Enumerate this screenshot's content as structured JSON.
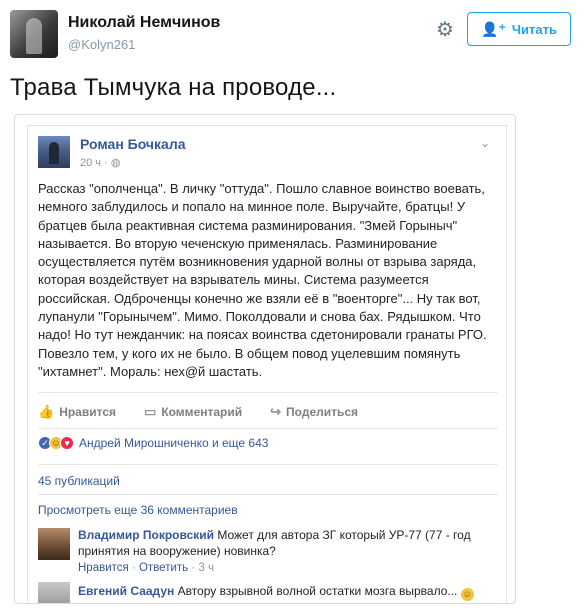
{
  "tweet": {
    "display_name": "Николай Немчинов",
    "handle": "@Kolyn261",
    "follow_label": "Читать",
    "text": "Трава Тымчука на проводе..."
  },
  "fb_post": {
    "author": "Роман Бочкала",
    "time": "20 ч · ",
    "body_lines": [
      "Рассказ \"ополченца\". В личку \"оттуда\". Пошло славное воинство воевать,",
      "немного заблудилось и попало на минное поле. Выручайте, братцы! У",
      "братцев была реактивная система разминирования. \"Змей Горыныч\"",
      "называется. Во вторую чеченскую применялась. Разминирование",
      "осуществляется путём возникновения ударной волны от взрыва заряда,",
      "которая воздействует на взрыватель мины. Система разумеется",
      "российская. Одброченцы конечно же взяли её в \"военторге\"... Ну так вот,",
      "лупанули \"Горынычем\". Мимо. Поколдовали и снова бах. Рядышком. Что",
      "надо! Но тут нежданчик: на поясах воинства сдетонировали гранаты РГО.",
      "Повезло тем, у кого их не было. В общем повод уцелевшим помянуть",
      "\"ихтамнет\". Мораль: нех@й шастать."
    ],
    "actions": {
      "like": "Нравится",
      "comment": "Комментарий",
      "share": "Поделиться"
    },
    "reactions_text": "Андрей Мирошниченко и еще 643",
    "shares_text": "45 публикаций",
    "more_comments": "Просмотреть еще 36 комментариев",
    "comments": [
      {
        "author": "Владимир Покровский",
        "text_line1": " Может для автора ЗГ который УР-77 (77 - год",
        "text_line2": "принятия на вооружение) новинка?",
        "like": "Нравится",
        "reply": "Ответить",
        "age": "3 ч"
      },
      {
        "author": "Евгений Саадун",
        "text_line1": " Автору взрывной волной остатки мозга вырвало... "
      }
    ]
  }
}
